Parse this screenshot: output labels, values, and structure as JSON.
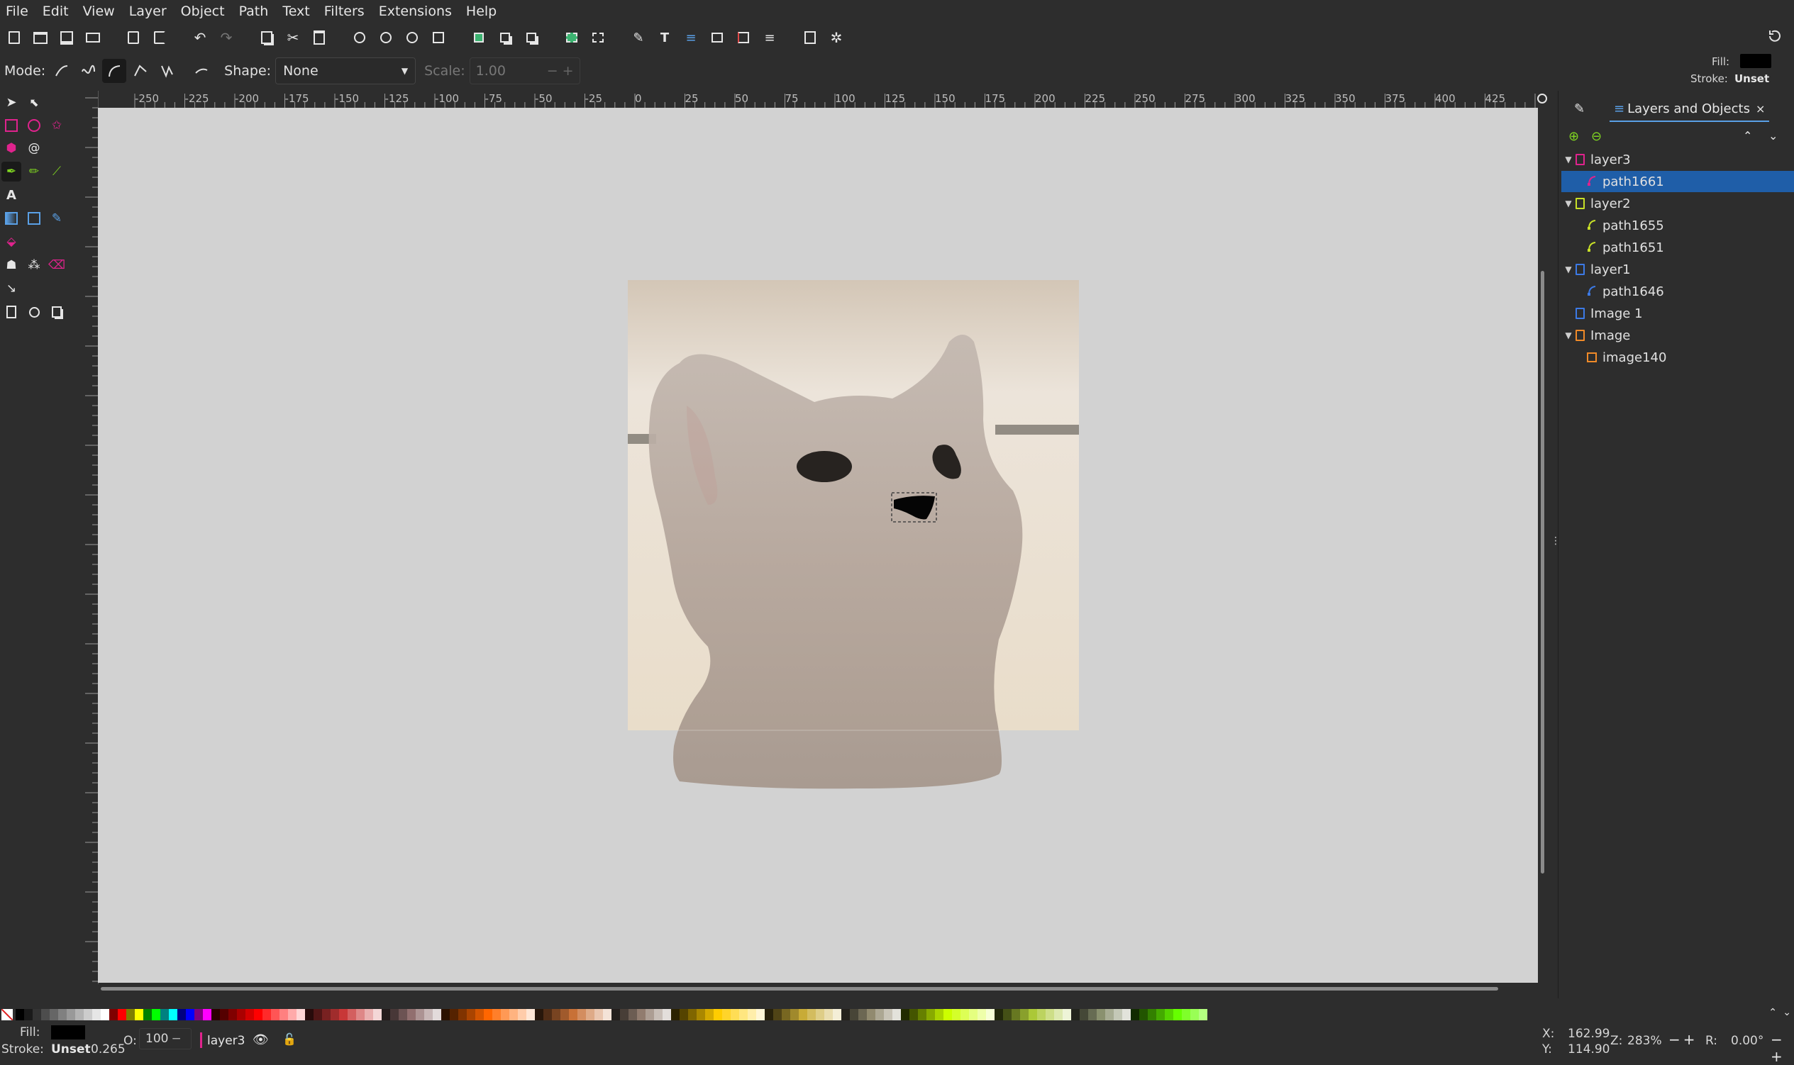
{
  "menu": [
    "File",
    "Edit",
    "View",
    "Layer",
    "Object",
    "Path",
    "Text",
    "Filters",
    "Extensions",
    "Help"
  ],
  "toolbar": {
    "icons": [
      "new-document-icon",
      "open-icon",
      "save-icon",
      "print-icon",
      "import-icon",
      "export-icon",
      "undo-icon",
      "redo-icon",
      "copy-icon",
      "cut-icon",
      "paste-icon",
      "zoom-selection-icon",
      "zoom-drawing-icon",
      "zoom-page-icon",
      "zoom-page-width-icon",
      "duplicate-icon",
      "clone-icon",
      "unlink-clone-icon",
      "group-icon",
      "ungroup-icon",
      "xml-editor-icon",
      "text-font-icon",
      "layers-icon",
      "object-properties-icon",
      "align-icon",
      "transform-icon",
      "document-properties-icon",
      "preferences-icon"
    ]
  },
  "controls": {
    "mode_label": "Mode:",
    "shape_label": "Shape:",
    "shape_value": "None",
    "scale_label": "Scale:",
    "scale_value": "1.00"
  },
  "fill_stroke": {
    "fill_label": "Fill:",
    "stroke_label": "Stroke:",
    "stroke_value": "Unset",
    "fill_color": "#000000"
  },
  "ruler": {
    "labels": [
      "-250",
      "-225",
      "-200",
      "-175",
      "-150",
      "-125",
      "-100",
      "-75",
      "-50",
      "-25",
      "0",
      "25",
      "50",
      "75",
      "100",
      "125",
      "150",
      "175",
      "200",
      "225",
      "250",
      "275",
      "300",
      "325",
      "350",
      "375",
      "400",
      "425"
    ]
  },
  "dock": {
    "tab_title": "Layers and Objects",
    "close": "×",
    "tree": [
      {
        "name": "layer3",
        "type": "layer",
        "color": "#e0238d",
        "expanded": true,
        "indent": 0
      },
      {
        "name": "path1661",
        "type": "path",
        "color": "#e0238d",
        "indent": 1,
        "selected": true
      },
      {
        "name": "layer2",
        "type": "layer",
        "color": "#c8e028",
        "expanded": true,
        "indent": 0
      },
      {
        "name": "path1655",
        "type": "path",
        "color": "#c8e028",
        "indent": 1
      },
      {
        "name": "path1651",
        "type": "path",
        "color": "#c8e028",
        "indent": 1
      },
      {
        "name": "layer1",
        "type": "layer",
        "color": "#3c7ae6",
        "expanded": true,
        "indent": 0
      },
      {
        "name": "path1646",
        "type": "path",
        "color": "#3c7ae6",
        "indent": 1
      },
      {
        "name": "Image 1",
        "type": "layer",
        "color": "#3c7ae6",
        "indent": 0
      },
      {
        "name": "Image",
        "type": "layer",
        "color": "#f08a28",
        "expanded": true,
        "indent": 0
      },
      {
        "name": "image140",
        "type": "image",
        "color": "#f08a28",
        "indent": 1
      }
    ]
  },
  "status": {
    "fill_label": "Fill:",
    "stroke_label": "Stroke:",
    "stroke_value": "Unset",
    "stroke_width": "0.265",
    "opacity_label": "O:",
    "opacity_value": "100",
    "layer_name": "layer3",
    "x_label": "X:",
    "x_value": "162.99",
    "y_label": "Y:",
    "y_value": "114.90",
    "zoom_label": "Z:",
    "zoom_value": "283%",
    "rotate_label": "R:",
    "rotate_value": "0.00°"
  },
  "palette": [
    "#000000",
    "#1a1a1a",
    "#333333",
    "#4d4d4d",
    "#666666",
    "#808080",
    "#999999",
    "#b3b3b3",
    "#cccccc",
    "#e6e6e6",
    "#ffffff",
    "#800000",
    "#ff0000",
    "#808000",
    "#ffff00",
    "#008000",
    "#00ff00",
    "#008080",
    "#00ffff",
    "#000080",
    "#0000ff",
    "#800080",
    "#ff00ff",
    "#2b0000",
    "#550000",
    "#800000",
    "#aa0000",
    "#d40000",
    "#ff0000",
    "#ff2a2a",
    "#ff5555",
    "#ff8080",
    "#ffaaaa",
    "#ffd5d5",
    "#280b0b",
    "#501616",
    "#782121",
    "#a02c2c",
    "#c83737",
    "#d35f5f",
    "#de8787",
    "#e9afaf",
    "#f4d7d7",
    "#241c1c",
    "#483737",
    "#6c5353",
    "#916f6f",
    "#ac9393",
    "#c8b7b7",
    "#e3dbdb",
    "#2b1100",
    "#552200",
    "#803300",
    "#aa4400",
    "#d45500",
    "#ff6600",
    "#ff7f2a",
    "#ff9955",
    "#ffb380",
    "#ffccaa",
    "#ffe6d5",
    "#28170b",
    "#502d16",
    "#784421",
    "#a05a2c",
    "#c87137",
    "#d38d5f",
    "#deaa87",
    "#e9c6af",
    "#f4e3d7",
    "#241f1c",
    "#483e37",
    "#6c5d53",
    "#917c6f",
    "#ac9d93",
    "#c8beb7",
    "#e3dedb",
    "#2b2200",
    "#554400",
    "#806600",
    "#aa8800",
    "#d4aa00",
    "#ffcc00",
    "#ffd42a",
    "#ffdd55",
    "#ffe680",
    "#ffeeaa",
    "#fff6d5",
    "#28220b",
    "#504416",
    "#786721",
    "#a0892c",
    "#c8ab37",
    "#d3bc5f",
    "#decd87",
    "#e9ddaf",
    "#f4eed7",
    "#24221c",
    "#484537",
    "#6c6753",
    "#918a6f",
    "#aca793",
    "#c8c4b7",
    "#e3e2db",
    "#222b00",
    "#445500",
    "#668000",
    "#88aa00",
    "#aad400",
    "#ccff00",
    "#d4ff2a",
    "#ddff55",
    "#e5ff80",
    "#eeffaa",
    "#f6ffd5",
    "#22280b",
    "#445016",
    "#677821",
    "#89a02c",
    "#abc837",
    "#bcd35f",
    "#cdde87",
    "#dde9af",
    "#eef4d7",
    "#22241c",
    "#454837",
    "#676c53",
    "#8a916f",
    "#a7ac93",
    "#c4c8b7",
    "#e2e3db",
    "#112b00",
    "#225500",
    "#338000",
    "#44aa00",
    "#55d400",
    "#66ff00",
    "#7fff2a",
    "#99ff55",
    "#b3ff80"
  ]
}
